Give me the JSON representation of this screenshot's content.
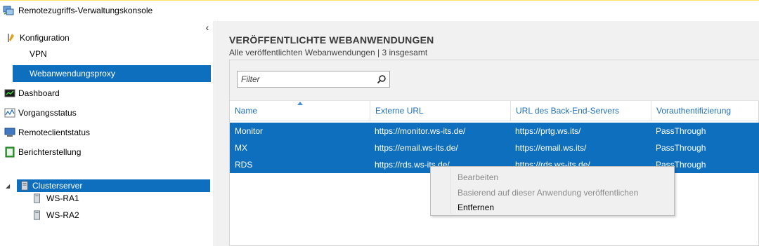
{
  "window": {
    "title": "Remotezugriffs-Verwaltungskonsole"
  },
  "sidebar": {
    "collapse_glyph": "‹",
    "konfiguration": "Konfiguration",
    "vpn": "VPN",
    "proxy": "Webanwendungsproxy",
    "dashboard": "Dashboard",
    "vorgangsstatus": "Vorgangsstatus",
    "remoteclientstatus": "Remoteclientstatus",
    "berichterstellung": "Berichterstellung",
    "tree": {
      "expand_glyph": "◢",
      "cluster": "Clusterserver",
      "servers": [
        "WS-RA1",
        "WS-RA2"
      ]
    }
  },
  "main": {
    "title": "VERÖFFENTLICHTE WEBANWENDUNGEN",
    "subtitle": "Alle veröffentlichten Webanwendungen | 3 insgesamt",
    "filter_placeholder": "Filter",
    "columns": [
      "Name",
      "Externe URL",
      "URL des Back-End-Servers",
      "Vorauthentifizierung"
    ],
    "rows": [
      [
        "Monitor",
        "https://monitor.ws-its.de/",
        "https://prtg.ws.its/",
        "PassThrough"
      ],
      [
        "MX",
        "https://email.ws-its.de/",
        "https://email.ws.its/",
        "PassThrough"
      ],
      [
        "RDS",
        "https://rds.ws-its.de/",
        "https://rds.ws-its.de/",
        "PassThrough"
      ]
    ]
  },
  "context_menu": {
    "items": [
      "Bearbeiten",
      "Basierend auf dieser Anwendung veröffentlichen",
      "Entfernen"
    ]
  },
  "colors": {
    "selection": "#0f6fbf",
    "header_text": "#1e6fb8"
  }
}
